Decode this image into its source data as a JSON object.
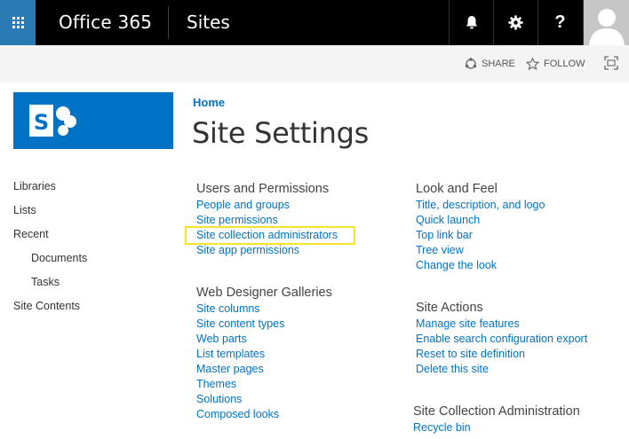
{
  "suitebar": {
    "brand": "Office 365",
    "app_title": "Sites",
    "help_label": "?",
    "accent_color": "#2a7ab5"
  },
  "actionbar": {
    "share_label": "SHARE",
    "follow_label": "FOLLOW"
  },
  "breadcrumb": "Home",
  "page_title": "Site Settings",
  "leftnav": {
    "items": [
      {
        "label": "Libraries"
      },
      {
        "label": "Lists"
      },
      {
        "label": "Recent"
      },
      {
        "label": "Documents"
      },
      {
        "label": "Tasks"
      },
      {
        "label": "Site Contents"
      }
    ]
  },
  "groups": {
    "users": {
      "title": "Users and Permissions",
      "links": [
        "People and groups",
        "Site permissions",
        "Site collection administrators",
        "Site app permissions"
      ]
    },
    "galleries": {
      "title": "Web Designer Galleries",
      "links": [
        "Site columns",
        "Site content types",
        "Web parts",
        "List templates",
        "Master pages",
        "Themes",
        "Solutions",
        "Composed looks"
      ]
    },
    "look": {
      "title": "Look and Feel",
      "links": [
        "Title, description, and logo",
        "Quick launch",
        "Top link bar",
        "Tree view",
        "Change the look"
      ]
    },
    "actions": {
      "title": "Site Actions",
      "links": [
        "Manage site features",
        "Enable search configuration export",
        "Reset to site definition",
        "Delete this site"
      ]
    },
    "collection": {
      "title": "Site Collection Administration",
      "links": [
        "Recycle bin"
      ]
    }
  },
  "colors": {
    "link": "#0072c6",
    "logo_bg": "#0072c6",
    "highlight": "#f5e42a"
  }
}
